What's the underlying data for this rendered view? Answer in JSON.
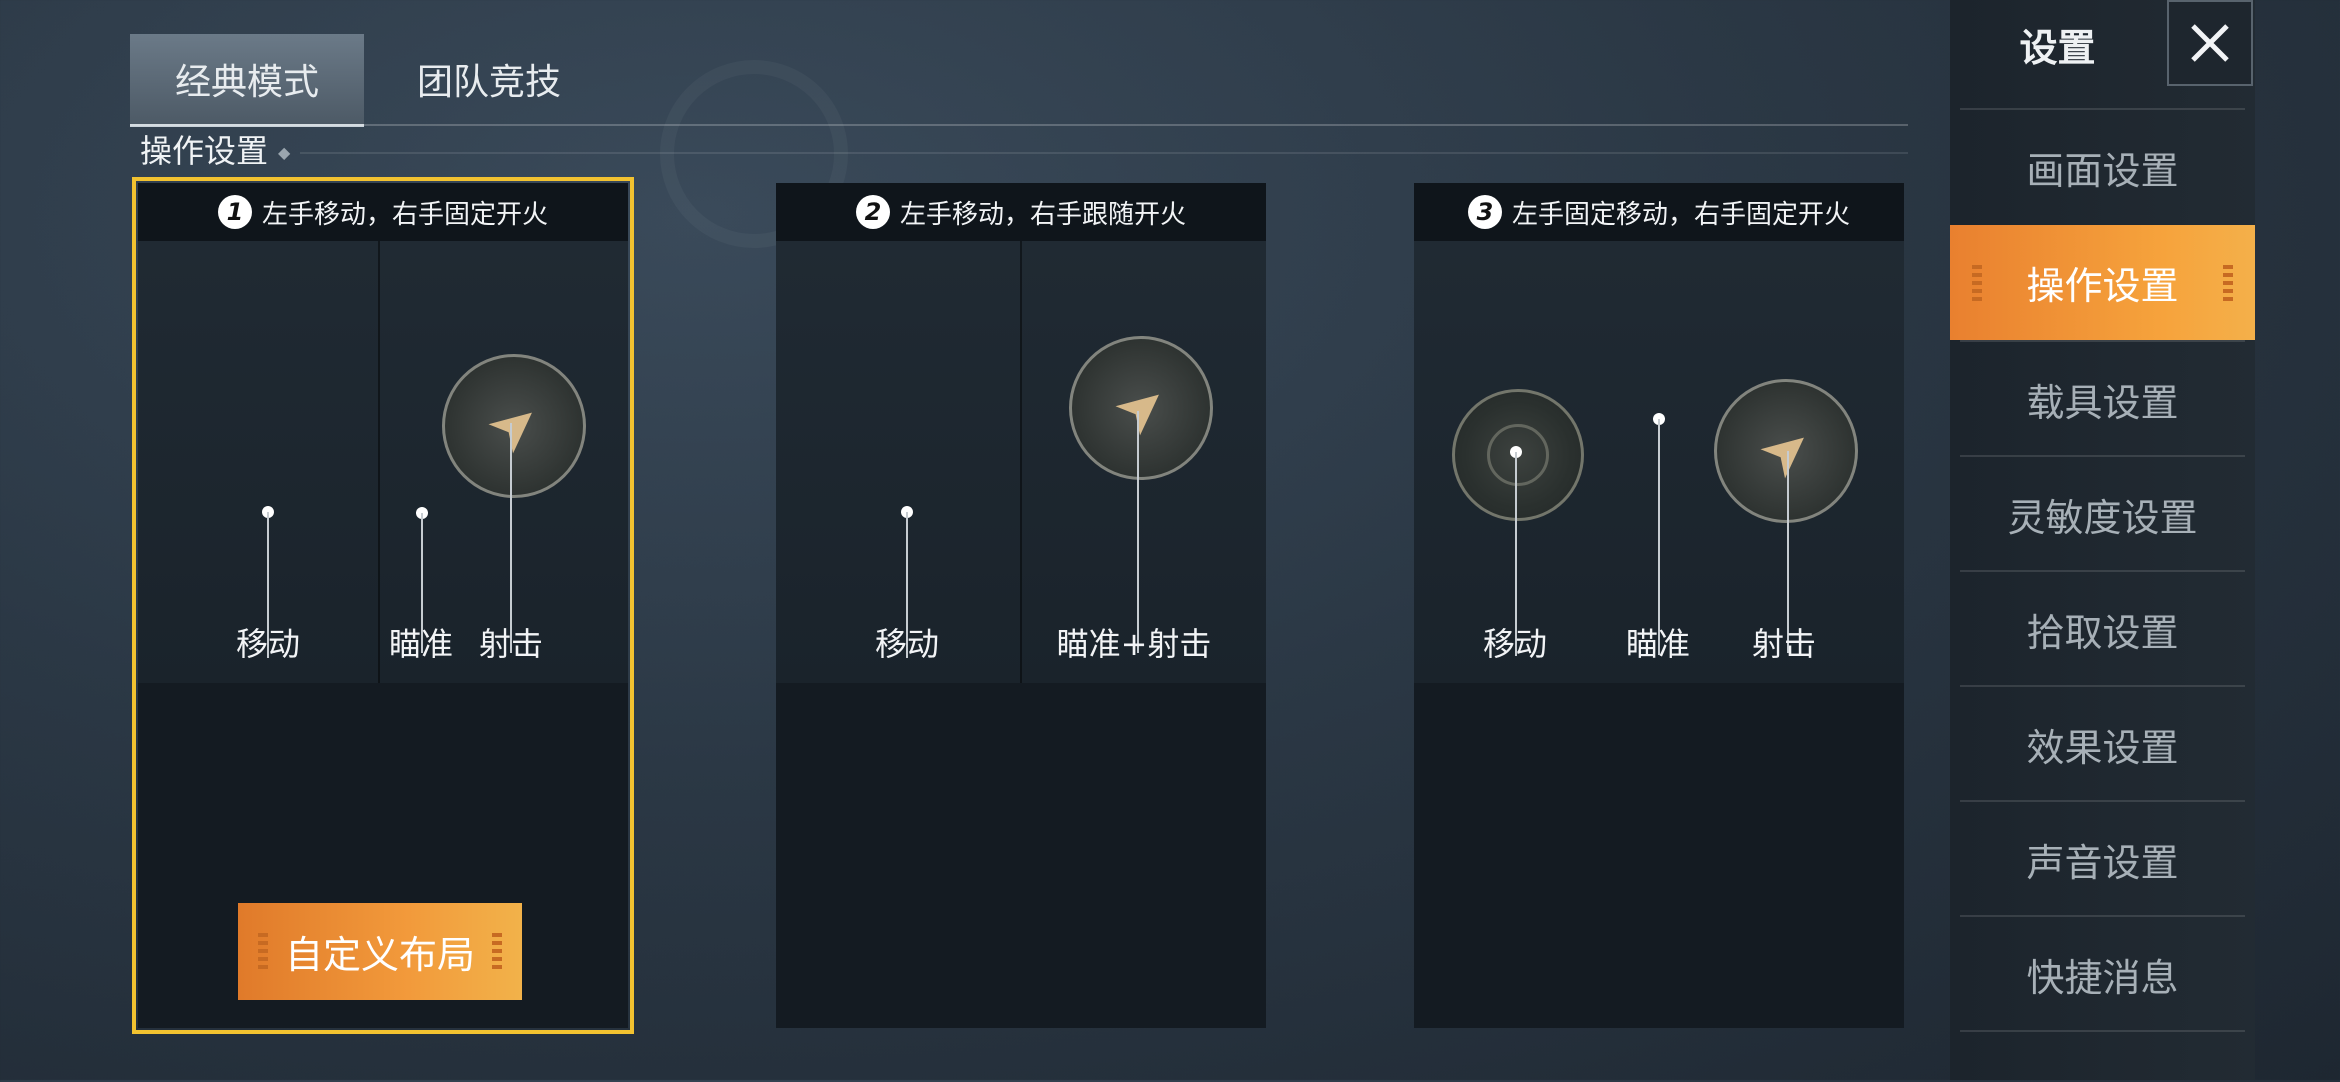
{
  "tabs": [
    {
      "label": "经典模式",
      "active": true
    },
    {
      "label": "团队竞技",
      "active": false
    }
  ],
  "section_title": "操作设置",
  "modes": [
    {
      "number": "1",
      "title": "左手移动，右手固定开火",
      "selected": true,
      "labels": [
        "移动",
        "瞄准",
        "射击"
      ],
      "custom_button": "自定义布局"
    },
    {
      "number": "2",
      "title": "左手移动，右手跟随开火",
      "selected": false,
      "labels": [
        "移动",
        "瞄准+射击"
      ]
    },
    {
      "number": "3",
      "title": "左手固定移动，右手固定开火",
      "selected": false,
      "labels": [
        "移动",
        "瞄准",
        "射击"
      ]
    }
  ],
  "sidebar": {
    "title": "设置",
    "items": [
      {
        "label": "画面设置",
        "active": false
      },
      {
        "label": "操作设置",
        "active": true
      },
      {
        "label": "载具设置",
        "active": false
      },
      {
        "label": "灵敏度设置",
        "active": false
      },
      {
        "label": "拾取设置",
        "active": false
      },
      {
        "label": "效果设置",
        "active": false
      },
      {
        "label": "声音设置",
        "active": false
      },
      {
        "label": "快捷消息",
        "active": false
      }
    ]
  },
  "colors": {
    "accent_orange": "#f29a3b",
    "selected_border": "#f2c230"
  },
  "icons": [
    "close-icon",
    "bullet-icon",
    "grip-icon"
  ]
}
